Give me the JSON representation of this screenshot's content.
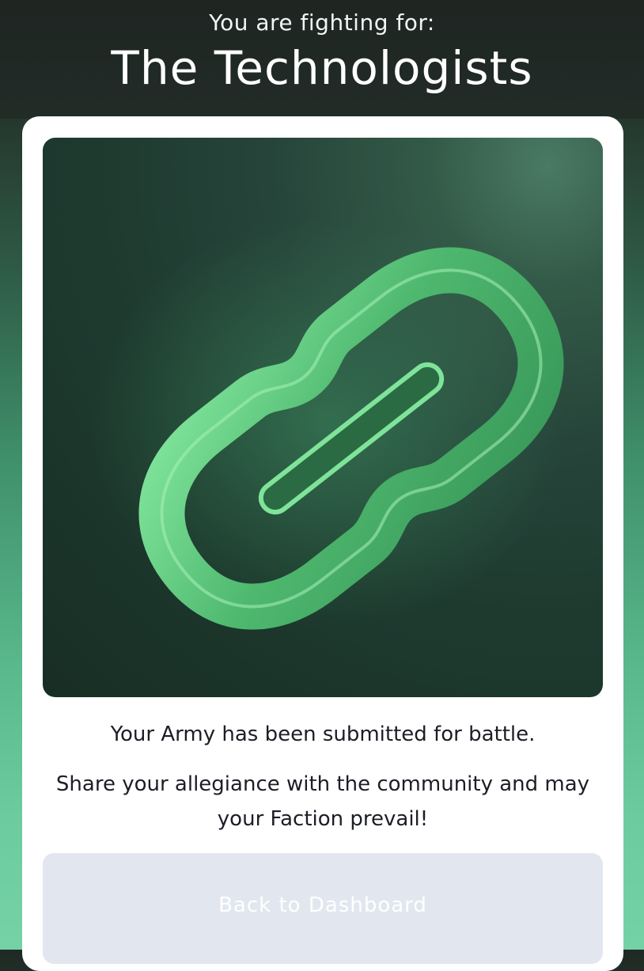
{
  "header": {
    "subtitle": "You are fighting for:",
    "faction_name": "The Technologists"
  },
  "card": {
    "image_icon": "chain-link-icon",
    "message_line1": "Your Army has been submitted for battle.",
    "message_line2": "Share your allegiance with the community and may your Faction prevail!",
    "back_button_label": "Back to Dashboard"
  },
  "colors": {
    "accent_green": "#6dcc9f",
    "link_glow": "#63d88f",
    "button_bg": "#e2e7ef",
    "text_dark": "#1c1e26"
  }
}
